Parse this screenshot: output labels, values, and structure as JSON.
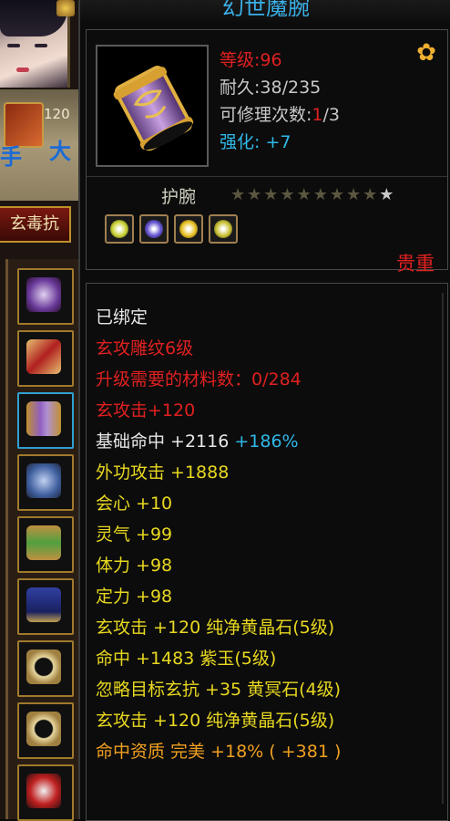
{
  "left": {
    "level_fragment": "120",
    "blue_char_right": "大",
    "blue_char_left": "手",
    "resist_label": "玄毒抗"
  },
  "item": {
    "name": "幻世魔腕",
    "level_label": "等级:96",
    "durability_label": "耐久:38/235",
    "repair_label_prefix": "可修理次数:",
    "repair_used": "1",
    "repair_total": "/3",
    "enhance_label": "强化:",
    "enhance_value": "+7",
    "type": "护腕",
    "stars_filled": 9,
    "stars_total": 10,
    "rarity": "贵重",
    "gem_slot_colors": [
      "#c8d030",
      "#6050d0",
      "#e8c020",
      "#c8c030"
    ]
  },
  "stats": {
    "bound": "已绑定",
    "carve": "玄攻雕纹6级",
    "upgrade_need": "升级需要的材料数：0/284",
    "carve_bonus": "玄攻击+120",
    "base_hit": "基础命中 +2116",
    "base_hit_pct": "+186%",
    "ext_attack": "外功攻击 +1888",
    "crit": "会心 +10",
    "spirit": "灵气 +99",
    "stamina": "体力 +98",
    "focus": "定力 +98",
    "gem_line_1": "玄攻击 +120 纯净黄晶石(5级)",
    "gem_line_2": "命中 +1483 紫玉(5级)",
    "gem_line_3": "忽略目标玄抗 +35 黄冥石(4级)",
    "gem_line_4": "玄攻击 +120 纯净黄晶石(5级)",
    "aptitude": "命中资质  完美 +18% ( +381 )"
  },
  "colors": {
    "title": "#3ab0e8",
    "red": "#e02020",
    "yellow": "#e8d820",
    "cyan": "#30b8e8",
    "orange": "#f0a020"
  }
}
